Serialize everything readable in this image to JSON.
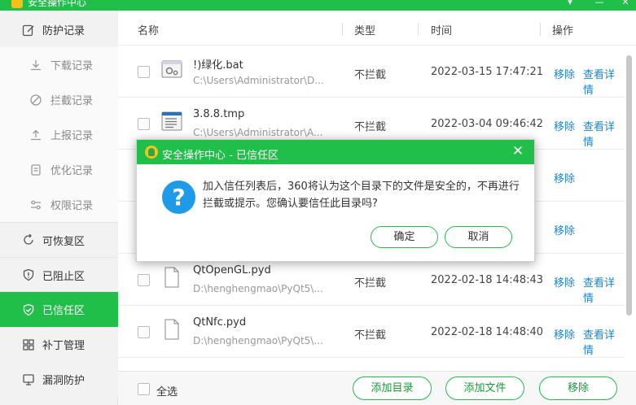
{
  "window": {
    "title": "安全操作中心",
    "controls": [
      "menu",
      "minimize",
      "close"
    ]
  },
  "sidebar": {
    "items": [
      {
        "label": "防护记录",
        "icon": "edit-icon",
        "type": "main"
      },
      {
        "label": "下载记录",
        "icon": "download-icon",
        "type": "sub"
      },
      {
        "label": "拦截记录",
        "icon": "block-icon",
        "type": "sub"
      },
      {
        "label": "上报记录",
        "icon": "upload-icon",
        "type": "sub"
      },
      {
        "label": "优化记录",
        "icon": "list-icon",
        "type": "sub"
      },
      {
        "label": "权限记录",
        "icon": "slider-icon",
        "type": "sub"
      },
      {
        "label": "可恢复区",
        "icon": "restore-icon",
        "type": "main"
      },
      {
        "label": "已阻止区",
        "icon": "shield-alert-icon",
        "type": "main"
      },
      {
        "label": "已信任区",
        "icon": "shield-check-icon",
        "type": "main",
        "active": true
      },
      {
        "label": "补丁管理",
        "icon": "grid-icon",
        "type": "main"
      },
      {
        "label": "漏洞防护",
        "icon": "monitor-icon",
        "type": "main"
      }
    ]
  },
  "table": {
    "headers": {
      "name": "名称",
      "type": "类型",
      "time": "时间",
      "action": "操作"
    },
    "rows": [
      {
        "name": "!)绿化.bat",
        "path": "C:\\Users\\Administrator\\D...",
        "type": "不拦截",
        "time": "2022-03-15 17:47:21",
        "remove": "移除",
        "detail": "查看详情",
        "icon": "bat-file-icon"
      },
      {
        "name": "3.8.8.tmp",
        "path": "C:\\Users\\Administrator\\A...",
        "type": "不拦截",
        "time": "2022-03-04 09:46:42",
        "remove": "移除",
        "detail": "查看详情",
        "icon": "tmp-file-icon"
      },
      {
        "name": "",
        "path": "",
        "type": "",
        "time": "",
        "remove": "移除",
        "detail": "",
        "icon": ""
      },
      {
        "name": "",
        "path": "",
        "type": "",
        "time": "",
        "remove": "移除",
        "detail": "",
        "icon": ""
      },
      {
        "name": "QtOpenGL.pyd",
        "path": "D:\\henghengmao\\PyQt5\\...",
        "type": "不拦截",
        "time": "2022-02-18 14:48:43",
        "remove": "移除",
        "detail": "查看详情",
        "icon": "file-icon"
      },
      {
        "name": "QtNfc.pyd",
        "path": "D:\\henghengmao\\PyQt5\\...",
        "type": "不拦截",
        "time": "2022-02-18 14:48:40",
        "remove": "移除",
        "detail": "查看详情",
        "icon": "file-icon"
      }
    ]
  },
  "footer": {
    "select_all": "全选",
    "add_dir": "添加目录",
    "add_file": "添加文件",
    "remove": "移除"
  },
  "dialog": {
    "title": "安全操作中心 - 已信任区",
    "message": "加入信任列表后，360将认为这个目录下的文件是安全的，不再进行拦截或提示。您确认要信任此目录吗?",
    "confirm": "确定",
    "cancel": "取消"
  },
  "colors": {
    "brand_green": "#1fbf4a",
    "link_blue": "#1a86d6",
    "question_blue": "#1e9be8"
  }
}
